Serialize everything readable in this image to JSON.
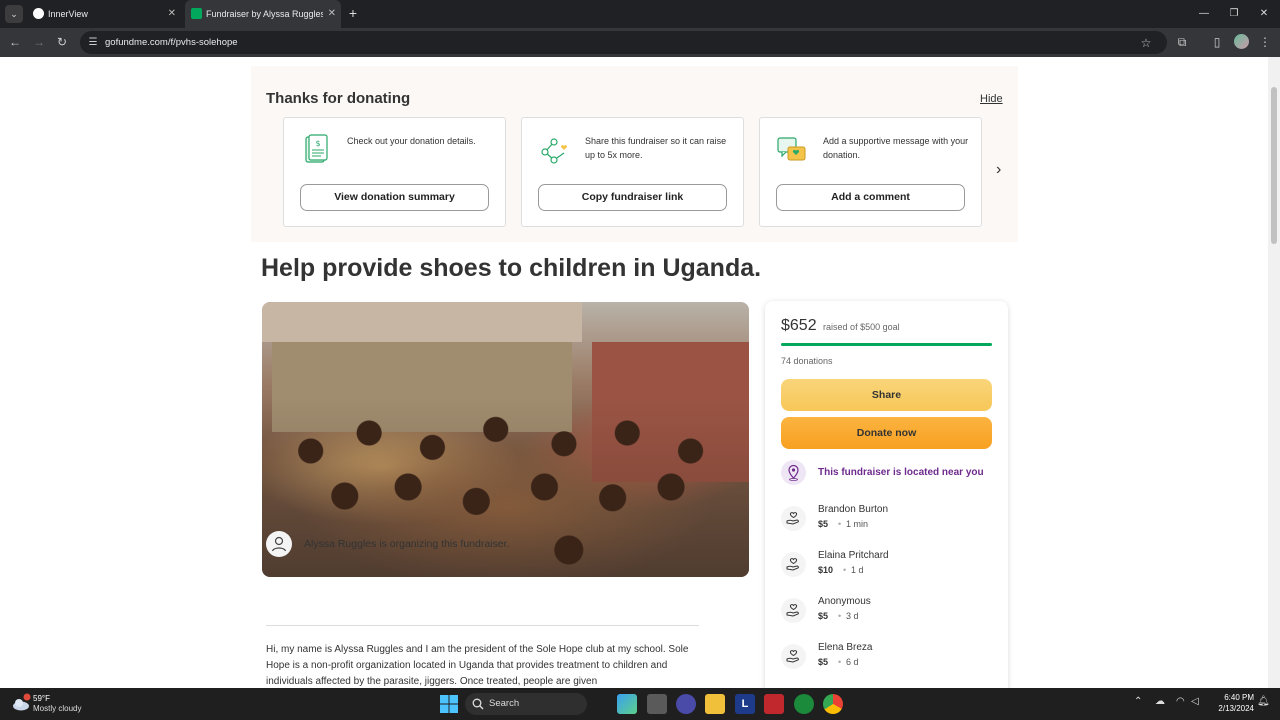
{
  "browser": {
    "tabs": [
      {
        "title": "InnerView",
        "active": false
      },
      {
        "title": "Fundraiser by Alyssa Ruggles : H",
        "active": true
      }
    ],
    "url": "gofundme.com/f/pvhs-solehope"
  },
  "thanks": {
    "title": "Thanks for donating",
    "hide": "Hide",
    "cards": [
      {
        "icon": "receipt-icon",
        "text": "Check out your donation details.",
        "button": "View donation summary"
      },
      {
        "icon": "share-network-icon",
        "text": "Share this fundraiser so it can raise up to 5x more.",
        "button": "Copy fundraiser link"
      },
      {
        "icon": "comment-bubbles-icon",
        "text": "Add a supportive message with your donation.",
        "button": "Add a comment"
      }
    ]
  },
  "fundraiser": {
    "title": "Help provide shoes to children in Uganda.",
    "organizer": "Alyssa Ruggles is organizing this fundraiser.",
    "story": "Hi, my name is Alyssa Ruggles and I am the president of the Sole Hope club at my school. Sole Hope is a non-profit organization located in Uganda that provides treatment to children and individuals affected by the parasite, jiggers. Once treated, people are given"
  },
  "sidebar": {
    "raised": "$652",
    "raised_of": "raised of $500 goal",
    "progress_fraction": 1.0,
    "donations_count": "74 donations",
    "share": "Share",
    "donate": "Donate now",
    "location": "This fundraiser is located near you",
    "donors": [
      {
        "name": "Brandon Burton",
        "amount": "$5",
        "time": "1 min"
      },
      {
        "name": "Elaina Pritchard",
        "amount": "$10",
        "time": "1 d"
      },
      {
        "name": "Anonymous",
        "amount": "$5",
        "time": "3 d"
      },
      {
        "name": "Elena Breza",
        "amount": "$5",
        "time": "6 d"
      }
    ]
  },
  "taskbar": {
    "temp": "59°F",
    "weather": "Mostly cloudy",
    "search": "Search",
    "time": "6:40 PM",
    "date": "2/13/2024"
  },
  "colors": {
    "green": "#02a95c",
    "accent_purple": "#6e2a8c",
    "share_yellow": "#f7c758",
    "donate_orange": "#f8a021"
  }
}
